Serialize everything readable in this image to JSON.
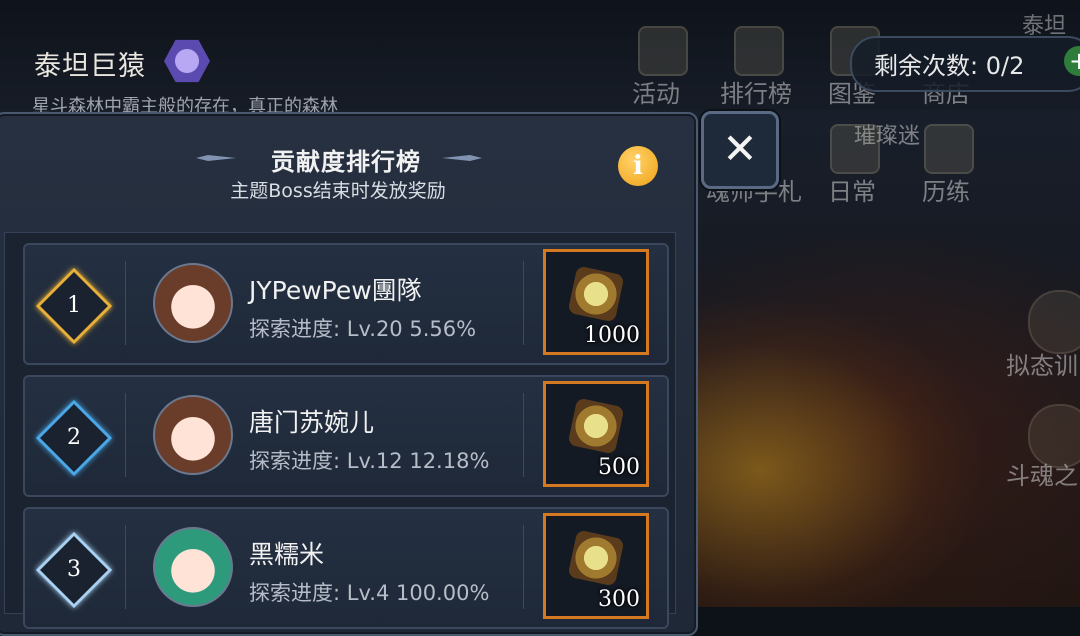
{
  "boss": {
    "name": "泰坦巨猿",
    "description": "星斗森林中霸主般的存在，真正的森林"
  },
  "top_menu": [
    "活动",
    "排行榜",
    "图鉴",
    "商店"
  ],
  "second_menu": [
    "魂师手札",
    "日常",
    "历练"
  ],
  "faded_text": "璀璨迷",
  "top_right_text": "泰坦",
  "remaining": {
    "label": "剩余次数:",
    "value": "0/2"
  },
  "right_side": [
    "拟态训",
    "斗魂之"
  ],
  "panel": {
    "title": "贡献度排行榜",
    "subtitle": "主题Boss结束时发放奖励",
    "info_label": "i",
    "close_label": "✕"
  },
  "rankings": [
    {
      "rank": "1",
      "name": "JYPewPew團隊",
      "progress_label": "探索进度:",
      "progress": "Lv.20 5.56%",
      "reward": "1000",
      "rank_color": "#e8b038"
    },
    {
      "rank": "2",
      "name": "唐门苏婉儿",
      "progress_label": "探索进度:",
      "progress": "Lv.12 12.18%",
      "reward": "500",
      "rank_color": "#4aa8e8"
    },
    {
      "rank": "3",
      "name": "黑糯米",
      "progress_label": "探索进度:",
      "progress": "Lv.4 100.00%",
      "reward": "300",
      "rank_color": "#a8d0f0"
    }
  ],
  "colors": {
    "accent": "#d4791f",
    "panel_bg": "#263040",
    "info": "#f0a116"
  }
}
